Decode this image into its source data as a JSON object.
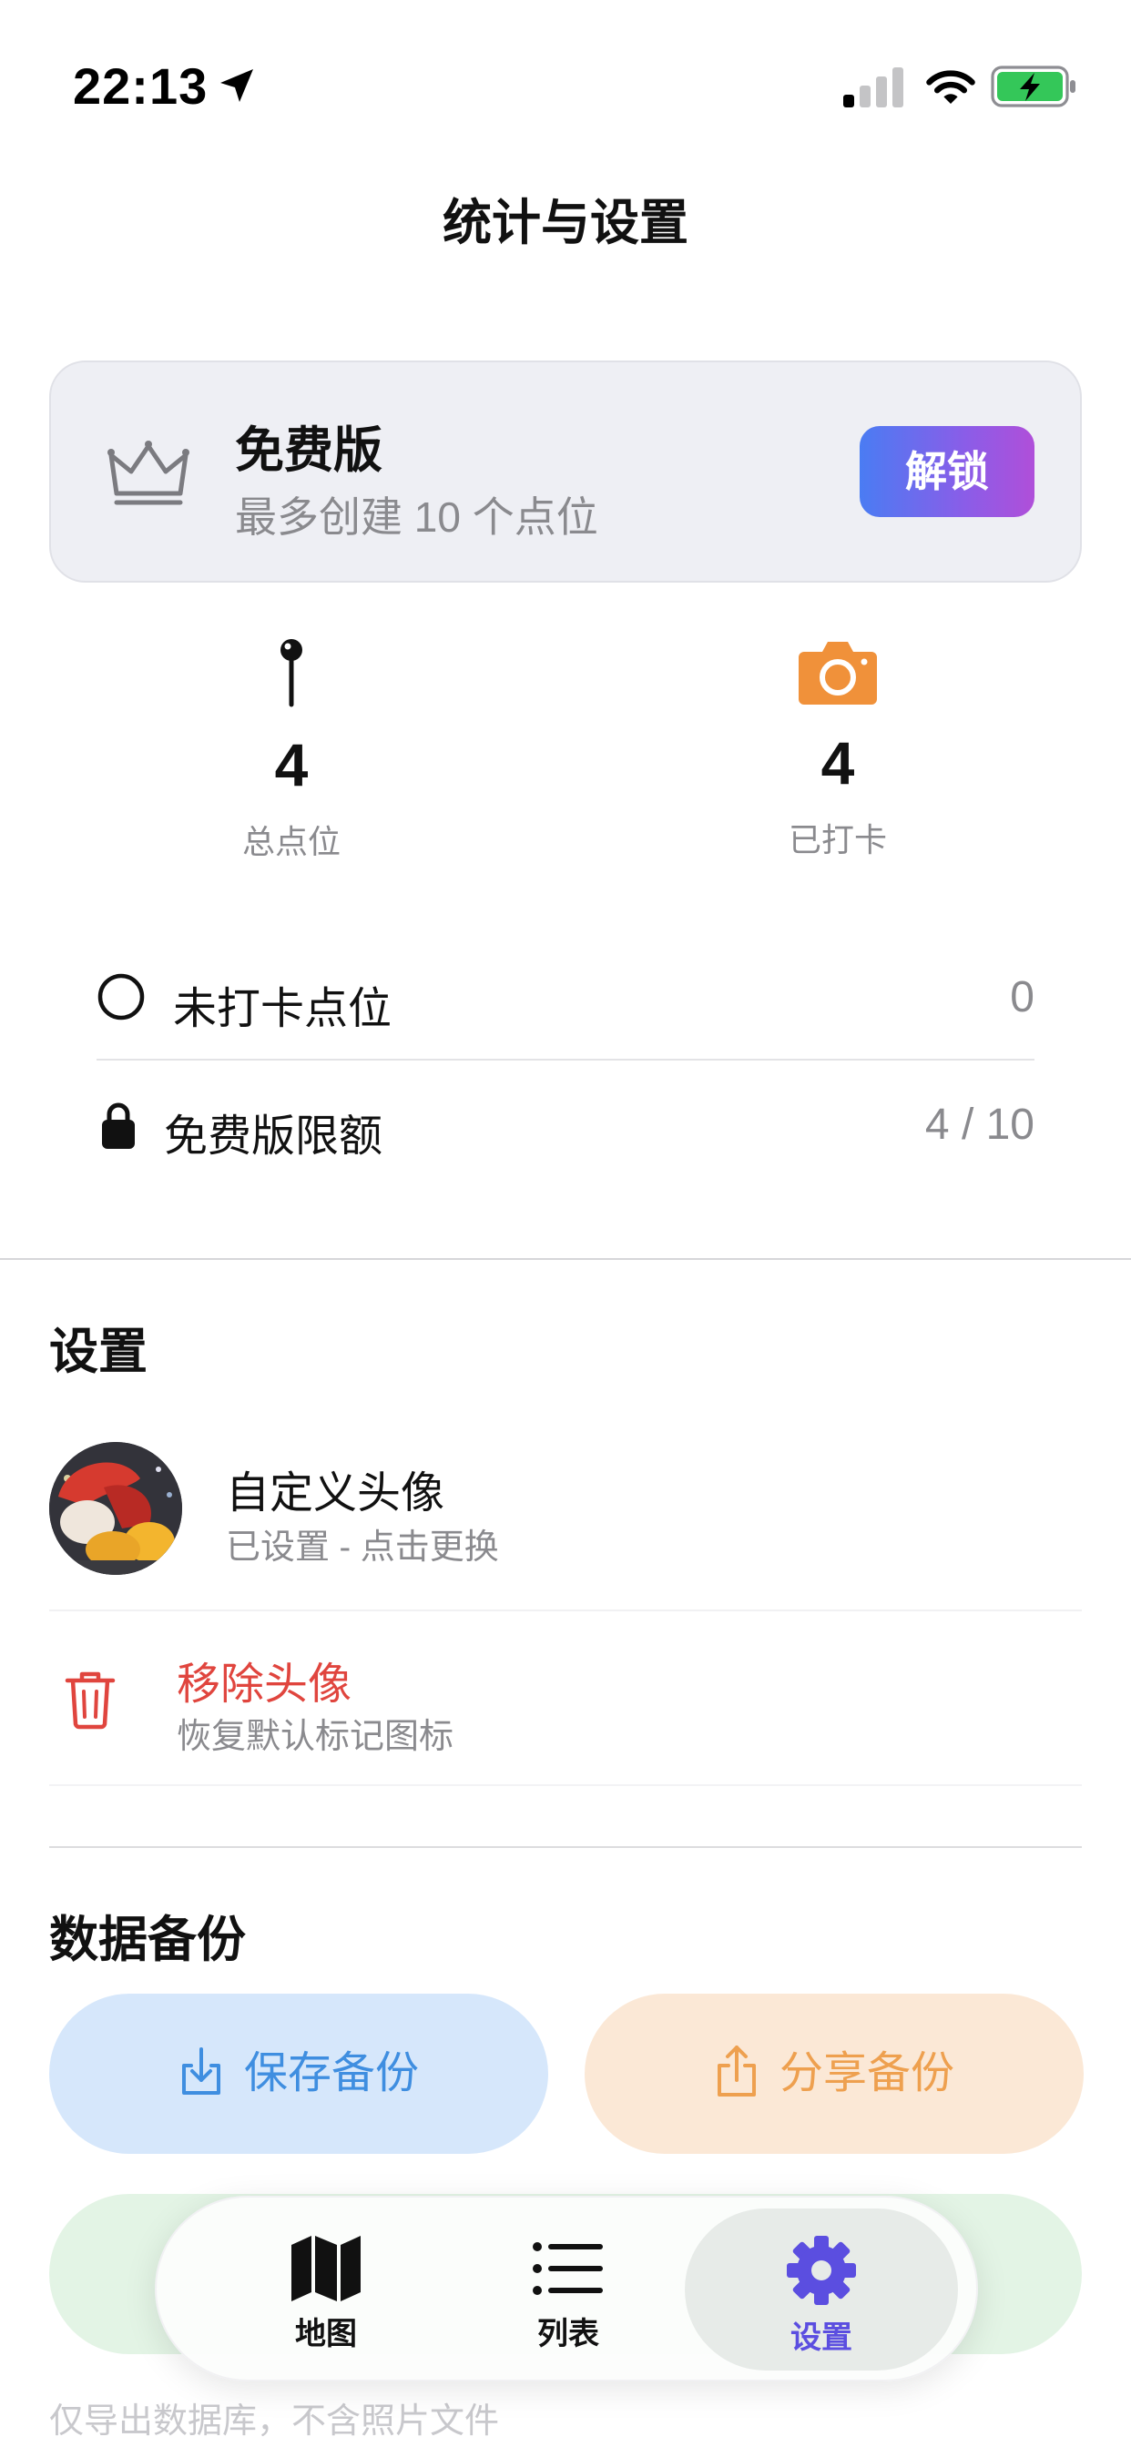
{
  "status_bar": {
    "time": "22:13",
    "icons": [
      "location-arrow-icon",
      "cellular-signal-icon",
      "wifi-icon",
      "battery-charging-icon"
    ],
    "battery_color": "#34c759"
  },
  "header": {
    "title": "统计与设置"
  },
  "plan": {
    "icon": "crown-icon",
    "title": "免费版",
    "subtitle": "最多创建 10 个点位",
    "unlock_label": "解锁"
  },
  "stats": [
    {
      "icon": "pin-icon",
      "value": "4",
      "label": "总点位"
    },
    {
      "icon": "camera-icon",
      "value": "4",
      "label": "已打卡",
      "icon_color": "#f0913a"
    }
  ],
  "info_rows": [
    {
      "icon": "circle-icon",
      "label": "未打卡点位",
      "value": "0"
    },
    {
      "icon": "lock-icon",
      "label": "免费版限额",
      "value": "4 / 10"
    }
  ],
  "settings": {
    "title": "设置",
    "avatar_row": {
      "title": "自定义头像",
      "subtitle": "已设置 - 点击更换"
    },
    "remove_row": {
      "icon": "trash-icon",
      "title": "移除头像",
      "subtitle": "恢复默认标记图标",
      "color": "#e0453e"
    }
  },
  "backup": {
    "title": "数据备份",
    "save_label": "保存备份",
    "share_label": "分享备份",
    "hint": "仅导出数据库，不含照片文件",
    "colors": {
      "save": "#3f8ee0",
      "share": "#eea04f"
    }
  },
  "tabs": [
    {
      "icon": "map-icon",
      "label": "地图",
      "active": false
    },
    {
      "icon": "list-icon",
      "label": "列表",
      "active": false
    },
    {
      "icon": "gear-icon",
      "label": "设置",
      "active": true
    }
  ],
  "accent_color": "#5b4ee0"
}
